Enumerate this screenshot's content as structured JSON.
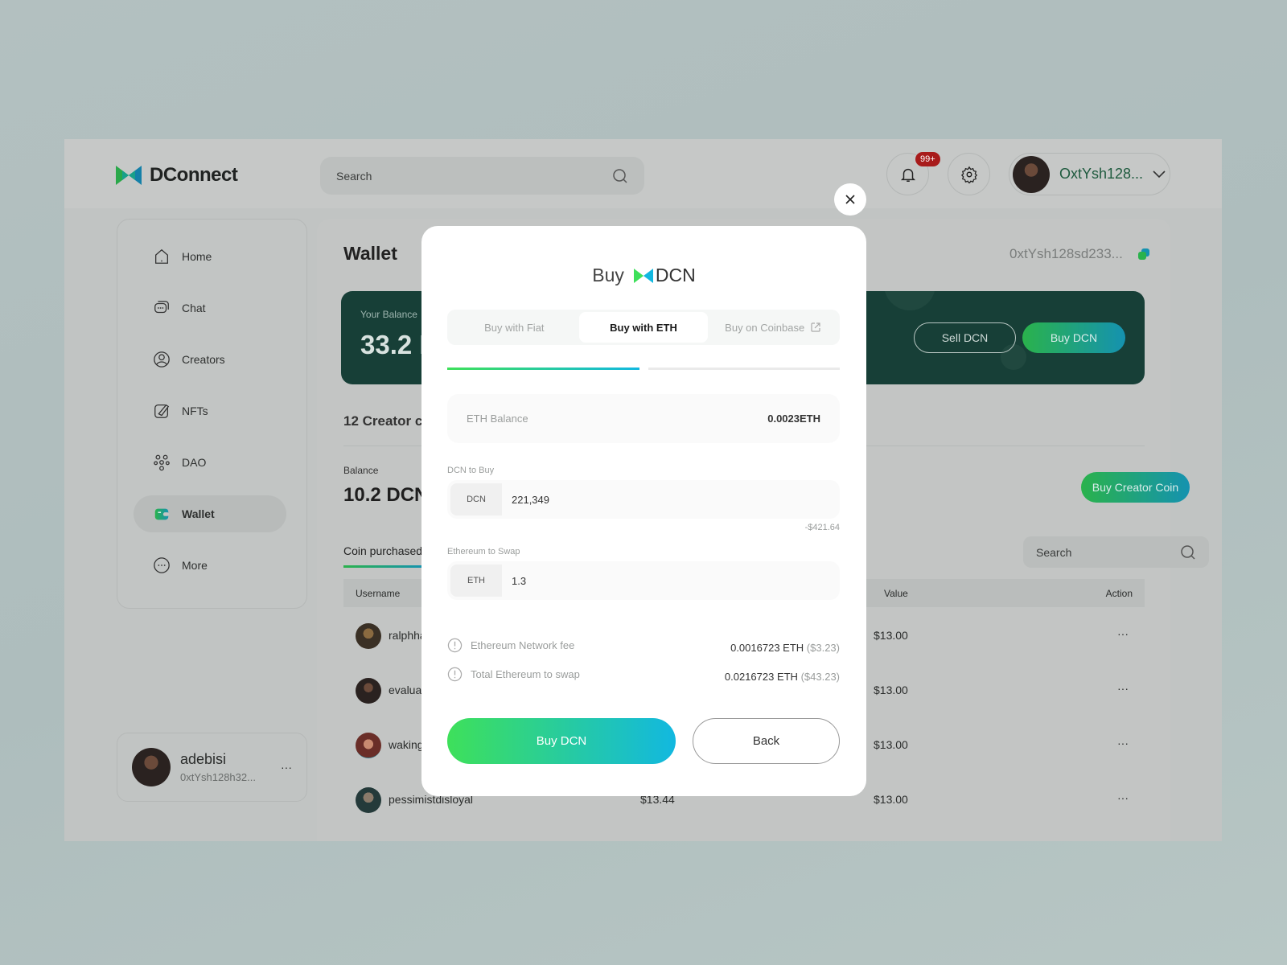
{
  "app": {
    "name": "DConnect"
  },
  "header": {
    "search_placeholder": "Search",
    "notification_count": "99+",
    "user": "OxtYsh128..."
  },
  "sidebar": {
    "items": [
      {
        "label": "Home",
        "icon": "home-icon"
      },
      {
        "label": "Chat",
        "icon": "chat-icon"
      },
      {
        "label": "Creators",
        "icon": "user-icon"
      },
      {
        "label": "NFTs",
        "icon": "brush-icon"
      },
      {
        "label": "DAO",
        "icon": "people-icon"
      },
      {
        "label": "Wallet",
        "icon": "wallet-icon",
        "active": true
      },
      {
        "label": "More",
        "icon": "more-icon"
      }
    ],
    "profile": {
      "name": "adebisi",
      "address": "0xtYsh128h32..."
    }
  },
  "wallet": {
    "title": "Wallet",
    "address": "0xtYsh128sd233...",
    "balance_label": "Your Balance",
    "balance": "33.2 D",
    "sell": "Sell DCN",
    "buy": "Buy DCN",
    "creator_heading": "12 Creator co",
    "creator_balance_label": "Balance",
    "creator_balance": "10.2 DCN",
    "buy_creator": "Buy Creator Coin",
    "tab": "Coin purchased",
    "search_placeholder": "Search",
    "columns": {
      "username": "Username",
      "value": "Value",
      "action": "Action"
    },
    "rows": [
      {
        "user": "ralphha",
        "price": "",
        "value": "$13.00"
      },
      {
        "user": "evaluat",
        "price": "",
        "value": "$13.00"
      },
      {
        "user": "waking",
        "price": "",
        "value": "$13.00"
      },
      {
        "user": "pessimistdisloyal",
        "price": "$13.44",
        "value": "$13.00"
      }
    ]
  },
  "modal": {
    "title_prefix": "Buy",
    "title_token": "DCN",
    "tabs": [
      {
        "label": "Buy with Fiat"
      },
      {
        "label": "Buy with ETH",
        "active": true
      },
      {
        "label": "Buy on Coinbase"
      }
    ],
    "progress_step": 1,
    "progress_total": 2,
    "eth_balance_label": "ETH Balance",
    "eth_balance": "0.0023ETH",
    "dcn_label": "DCN to Buy",
    "dcn_prefix": "DCN",
    "dcn_value": "221,349",
    "dcn_usd": "-$421.64",
    "eth_label": "Ethereum to Swap",
    "eth_prefix": "ETH",
    "eth_value": "1.3",
    "fee_label": "Ethereum Network fee",
    "fee_eth": "0.0016723 ETH",
    "fee_usd": "($3.23)",
    "total_label": "Total Ethereum to swap",
    "total_eth": "0.0216723 ETH",
    "total_usd": "($43.23)",
    "buy_button": "Buy DCN",
    "back_button": "Back"
  },
  "colors": {
    "brand_green": "#2ab24c",
    "brand_blue": "#1592b0",
    "banner": "#173f37",
    "badge": "#a81b1b"
  }
}
